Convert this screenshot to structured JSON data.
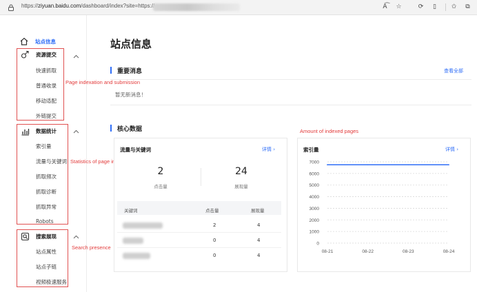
{
  "browser": {
    "url_prefix": "https://",
    "url_host": "ziyuan.baidu.com",
    "url_path": "/dashboard/index?site=https://"
  },
  "sidebar": {
    "home_label": "站点信息",
    "groups": [
      {
        "title": "资源提交",
        "items": [
          "快速抓取",
          "普通收录",
          "移动适配",
          "外链提交"
        ]
      },
      {
        "title": "数据统计",
        "items": [
          "索引量",
          "流量与关键词",
          "抓取频次",
          "抓取诊断",
          "抓取异常",
          "Robots"
        ]
      },
      {
        "title": "搜索展现",
        "items": [
          "站点属性",
          "站点子链",
          "视频极速服务"
        ]
      }
    ]
  },
  "annotations": {
    "resource_submit": "Page indexation and submission",
    "stats": "Statistics of page indexation and crawling",
    "search_presence": "Search presence",
    "indexed_amount": "Amount of indexed pages"
  },
  "main": {
    "title": "站点信息",
    "important": {
      "title": "重要消息",
      "view_all": "查看全部",
      "empty": "暂无新消息！"
    },
    "core": {
      "title": "核心数据"
    },
    "traffic_card": {
      "title": "流量与关键词",
      "detail": "详情 ›",
      "clicks_value": "2",
      "clicks_label": "点击量",
      "impressions_value": "24",
      "impressions_label": "展现量",
      "table": {
        "headers": [
          "关键词",
          "点击量",
          "展现量"
        ],
        "rows": [
          {
            "clicks": "2",
            "impressions": "4"
          },
          {
            "clicks": "0",
            "impressions": "4"
          },
          {
            "clicks": "0",
            "impressions": "4"
          }
        ]
      }
    },
    "index_card": {
      "title": "索引量",
      "detail": "详情 ›"
    }
  },
  "chart_data": {
    "type": "line",
    "title": "",
    "x": [
      "08-21",
      "08-22",
      "08-23",
      "08-24"
    ],
    "series": [
      {
        "values": [
          6750,
          6750,
          6750,
          6750
        ]
      }
    ],
    "ylim": [
      0,
      7000
    ],
    "yticks": [
      0,
      1000,
      2000,
      3000,
      4000,
      5000,
      6000,
      7000
    ],
    "grid": true,
    "line_color": "#2f6ef7"
  }
}
